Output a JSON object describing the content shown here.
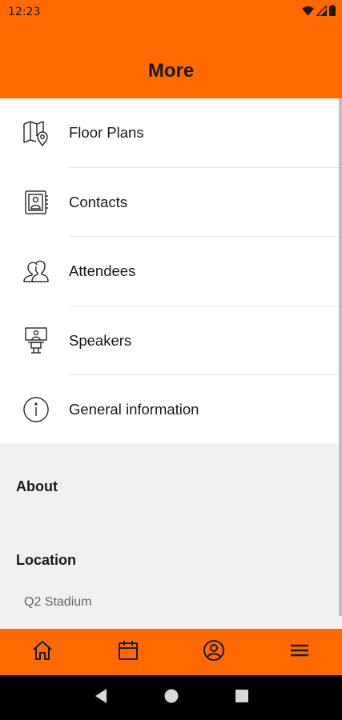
{
  "status_bar": {
    "time": "12:23",
    "icons": [
      "wifi-icon",
      "signal-icon",
      "battery-icon"
    ]
  },
  "header": {
    "title": "More",
    "background_color": "#ff6a00"
  },
  "menu": {
    "items": [
      {
        "label": "Floor Plans",
        "icon": "map-pin-icon"
      },
      {
        "label": "Contacts",
        "icon": "contact-book-icon"
      },
      {
        "label": "Attendees",
        "icon": "people-icon"
      },
      {
        "label": "Speakers",
        "icon": "speaker-podium-icon"
      },
      {
        "label": "General information",
        "icon": "info-icon"
      }
    ]
  },
  "info": {
    "about_heading": "About",
    "location_heading": "Location",
    "location_value": "Q2 Stadium"
  },
  "bottom_nav": {
    "items": [
      "home-icon",
      "calendar-icon",
      "profile-icon",
      "menu-icon"
    ],
    "background_color": "#ff6a00"
  },
  "system_nav": {
    "items": [
      "back-icon",
      "home-circle-icon",
      "recents-icon"
    ]
  }
}
